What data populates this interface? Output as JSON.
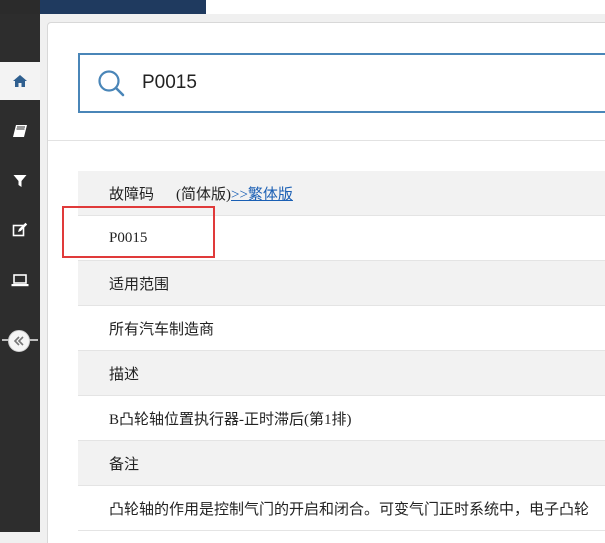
{
  "search": {
    "value": "P0015"
  },
  "lang": {
    "title": "故障码",
    "current": "(简体版)",
    "switch_label": ">>繁体版"
  },
  "code": {
    "value": "P0015"
  },
  "scope": {
    "label": "适用范围",
    "value": "所有汽车制造商"
  },
  "description": {
    "label": "描述",
    "value": "B凸轮轴位置执行器-正时滞后(第1排)"
  },
  "notes": {
    "label": "备注",
    "value": "凸轮轴的作用是控制气门的开启和闭合。可变气门正时系统中，电子凸轮"
  },
  "sidebar": {
    "items": [
      {
        "icon": "home-icon",
        "active": true
      },
      {
        "icon": "book-icon",
        "active": false
      },
      {
        "icon": "filter-icon",
        "active": false
      },
      {
        "icon": "edit-icon",
        "active": false
      },
      {
        "icon": "laptop-icon",
        "active": false
      }
    ],
    "collapse_icon": "double-chevron-left-icon"
  },
  "colors": {
    "sidebar_bg": "#2d2d2d",
    "accent_blue": "#4a86b8",
    "link": "#1a5fb4",
    "highlight_red": "#e03a3a",
    "header_row_bg": "#f2f2f2"
  }
}
